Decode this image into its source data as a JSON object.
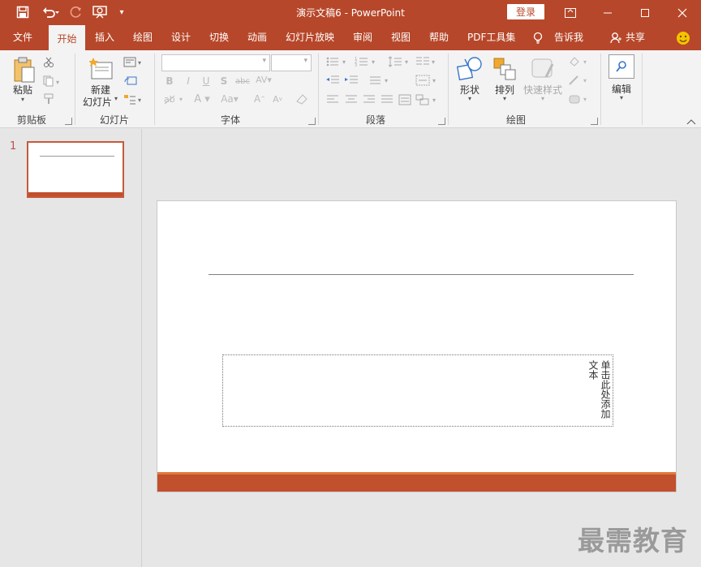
{
  "title_bar": {
    "doc_title": "演示文稿6  -  PowerPoint",
    "login_label": "登录",
    "quick_access": [
      "save-icon",
      "undo-icon",
      "redo-icon",
      "present-icon",
      "customize-icon"
    ]
  },
  "tabs": [
    "文件",
    "开始",
    "插入",
    "绘图",
    "设计",
    "切换",
    "动画",
    "幻灯片放映",
    "审阅",
    "视图",
    "帮助",
    "PDF工具集"
  ],
  "active_tab": "开始",
  "tell_me": "告诉我",
  "share_label": "共享",
  "ribbon": {
    "clipboard": {
      "paste_label": "粘贴",
      "group_label": "剪贴板"
    },
    "slides": {
      "new_slide_line1": "新建",
      "new_slide_line2": "幻灯片",
      "group_label": "幻灯片"
    },
    "font": {
      "group_label": "字体",
      "font_name": "",
      "font_size": ""
    },
    "paragraph": {
      "group_label": "段落"
    },
    "drawing": {
      "shapes_label": "形状",
      "arrange_label": "排列",
      "quick_styles_label": "快速样式",
      "group_label": "绘图"
    },
    "editing": {
      "edit_label": "编辑"
    }
  },
  "thumbnails": [
    {
      "number": "1"
    }
  ],
  "slide": {
    "placeholder_text": "单击此处添加文本"
  },
  "watermark": "最需教育",
  "colors": {
    "accent": "#b7472a",
    "slide_bar": "#c1502d",
    "slide_bar_top": "#e07a3a"
  }
}
